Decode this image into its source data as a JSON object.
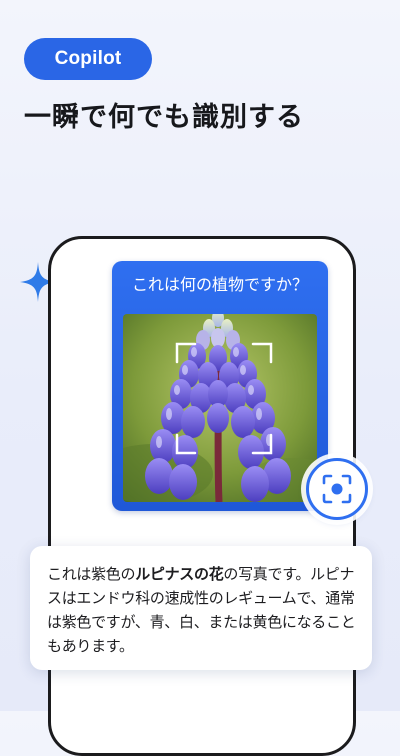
{
  "badge": {
    "label": "Copilot"
  },
  "headline": "一瞬で何でも識別する",
  "chat": {
    "question": "これは何の植物ですか？",
    "image_subject": "lupine flower photo"
  },
  "lens_button": {
    "icon": "camera-scan-icon"
  },
  "answer": {
    "pre": "これは紫色の",
    "bold": "ルピナスの花",
    "post": "の写真です。ルピナスはエンドウ科の速成性のレギュームで、通常は紫色ですが、青、白、または黄色になることもあります。"
  },
  "colors": {
    "accent": "#2a66e6",
    "sparkle": "#2f7be8",
    "background": "#eef1fb"
  }
}
